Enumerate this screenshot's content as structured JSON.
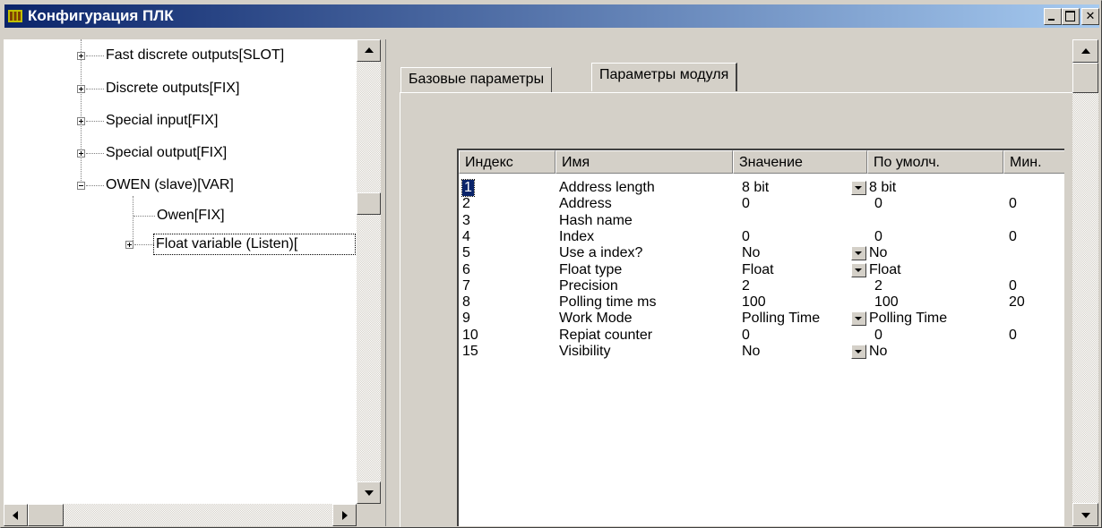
{
  "window": {
    "title": "Конфигурация ПЛК"
  },
  "tree": {
    "items": [
      {
        "label": "Fast discrete outputs[SLOT]",
        "expander": "plus"
      },
      {
        "label": "Discrete outputs[FIX]",
        "expander": "plus"
      },
      {
        "label": "Special input[FIX]",
        "expander": "plus"
      },
      {
        "label": "Special output[FIX]",
        "expander": "plus"
      },
      {
        "label": "OWEN (slave)[VAR]",
        "expander": "minus"
      },
      {
        "label": "Owen[FIX]",
        "expander": "none"
      },
      {
        "label": "Float variable (Listen)[",
        "expander": "plus",
        "focused": true
      }
    ]
  },
  "tabs": [
    {
      "label": "Базовые параметры",
      "active": false
    },
    {
      "label": "Параметры модуля",
      "active": true
    }
  ],
  "grid": {
    "columns": [
      "Индекс",
      "Имя",
      "Значение",
      "По умолч.",
      "Мин."
    ],
    "rows": [
      {
        "index": "1",
        "name": "Address length",
        "value": "8 bit",
        "default": "8 bit",
        "min": "",
        "dropdown": true,
        "selected": true
      },
      {
        "index": "2",
        "name": "Address",
        "value": "0",
        "default": "0",
        "min": "0",
        "dropdown": false
      },
      {
        "index": "3",
        "name": "Hash name",
        "value": "",
        "default": "",
        "min": "",
        "dropdown": false
      },
      {
        "index": "4",
        "name": "Index",
        "value": "0",
        "default": "0",
        "min": "0",
        "dropdown": false
      },
      {
        "index": "5",
        "name": "Use a index?",
        "value": "No",
        "default": "No",
        "min": "",
        "dropdown": true
      },
      {
        "index": "6",
        "name": "Float type",
        "value": "Float",
        "default": "Float",
        "min": "",
        "dropdown": true
      },
      {
        "index": "7",
        "name": "Precision",
        "value": "2",
        "default": "2",
        "min": "0",
        "dropdown": false
      },
      {
        "index": "8",
        "name": "Polling time ms",
        "value": "100",
        "default": "100",
        "min": "20",
        "dropdown": false
      },
      {
        "index": "9",
        "name": "Work Mode",
        "value": "Polling Time",
        "default": "Polling Time",
        "min": "",
        "dropdown": true
      },
      {
        "index": "10",
        "name": "Repiat counter",
        "value": "0",
        "default": "0",
        "min": "0",
        "dropdown": false
      },
      {
        "index": "15",
        "name": "Visibility",
        "value": "No",
        "default": "No",
        "min": "",
        "dropdown": true
      }
    ]
  },
  "colors": {
    "titlebar": "#0a246a",
    "face": "#d4d0c8",
    "selection": "#0a246a"
  }
}
